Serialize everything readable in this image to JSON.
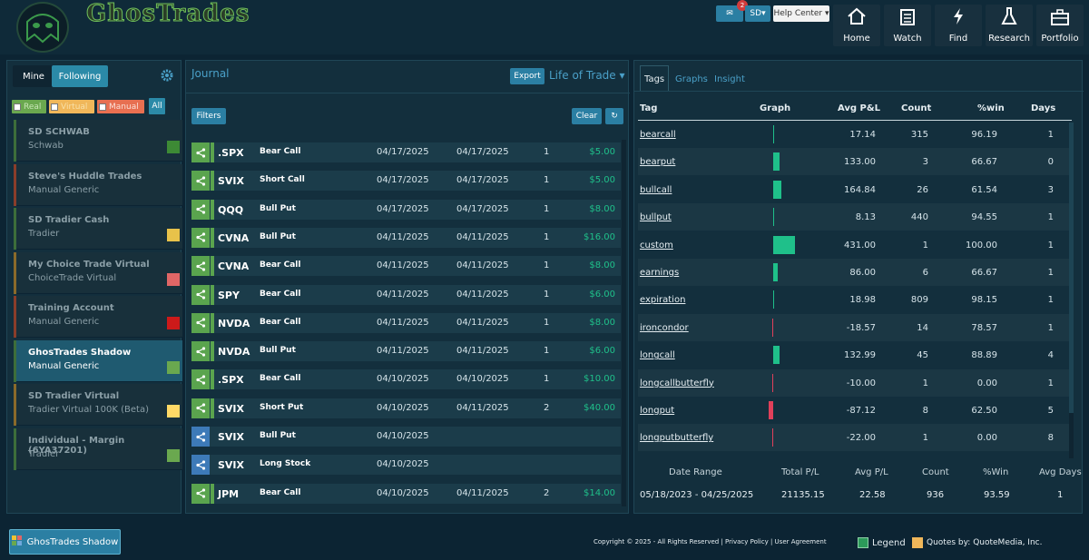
{
  "header": {
    "brand": "GhosTrades",
    "mail_count": "2",
    "user_initials": "SD",
    "help_label": "Help Center",
    "nav": [
      {
        "label": "Home",
        "icon": "home-icon"
      },
      {
        "label": "Watch",
        "icon": "clipboard-icon"
      },
      {
        "label": "Find",
        "icon": "lightning-icon"
      },
      {
        "label": "Research",
        "icon": "flask-icon"
      },
      {
        "label": "Portfolio",
        "icon": "briefcase-icon"
      }
    ]
  },
  "accounts_panel": {
    "tabs": [
      "Mine",
      "Following"
    ],
    "filters": [
      "Real",
      "Virtual",
      "Manual",
      "All"
    ],
    "accounts": [
      {
        "name": "SD SCHWAB",
        "type": "Schwab",
        "color": "#3d8a35"
      },
      {
        "name": "Steve's Huddle Trades",
        "type": "Manual Generic",
        "color": ""
      },
      {
        "name": "SD Tradier Cash",
        "type": "Tradier",
        "color": "#e8c24a"
      },
      {
        "name": "My Choice Trade Virtual",
        "type": "ChoiceTrade Virtual",
        "color": "#e06666"
      },
      {
        "name": "Training Account",
        "type": "Manual Generic",
        "color": "#cc1a1a"
      },
      {
        "name": "GhosTrades Shadow",
        "type": "Manual Generic",
        "color": "#6aa84f"
      },
      {
        "name": "SD Tradier Virtual",
        "type": "Tradier Virtual 100K (Beta)",
        "color": "#ffd966"
      },
      {
        "name": "Individual - Margin (6YA37201)",
        "type": "Tradier",
        "color": "#6aa84f"
      }
    ]
  },
  "journal": {
    "title": "Journal",
    "export_label": "Export",
    "view_label": "Life of Trade",
    "filters_label": "Filters",
    "clear_label": "Clear",
    "rows": [
      {
        "symbol": ".SPX",
        "strategy": "Bear Call",
        "opened": "04/17/2025",
        "closed": "04/17/2025",
        "count": "1",
        "pnl": "$5.00",
        "status": "closed"
      },
      {
        "symbol": "SVIX",
        "strategy": "Short Call",
        "opened": "04/17/2025",
        "closed": "04/17/2025",
        "count": "1",
        "pnl": "$5.00",
        "status": "closed"
      },
      {
        "symbol": "QQQ",
        "strategy": "Bull Put",
        "opened": "04/17/2025",
        "closed": "04/17/2025",
        "count": "1",
        "pnl": "$8.00",
        "status": "closed"
      },
      {
        "symbol": "CVNA",
        "strategy": "Bull Put",
        "opened": "04/11/2025",
        "closed": "04/11/2025",
        "count": "1",
        "pnl": "$16.00",
        "status": "closed"
      },
      {
        "symbol": "CVNA",
        "strategy": "Bear Call",
        "opened": "04/11/2025",
        "closed": "04/11/2025",
        "count": "1",
        "pnl": "$8.00",
        "status": "closed"
      },
      {
        "symbol": "SPY",
        "strategy": "Bear Call",
        "opened": "04/11/2025",
        "closed": "04/11/2025",
        "count": "1",
        "pnl": "$6.00",
        "status": "closed"
      },
      {
        "symbol": "NVDA",
        "strategy": "Bear Call",
        "opened": "04/11/2025",
        "closed": "04/11/2025",
        "count": "1",
        "pnl": "$8.00",
        "status": "closed"
      },
      {
        "symbol": "NVDA",
        "strategy": "Bull Put",
        "opened": "04/11/2025",
        "closed": "04/11/2025",
        "count": "1",
        "pnl": "$6.00",
        "status": "closed"
      },
      {
        "symbol": ".SPX",
        "strategy": "Bear Call",
        "opened": "04/10/2025",
        "closed": "04/10/2025",
        "count": "1",
        "pnl": "$10.00",
        "status": "closed"
      },
      {
        "symbol": "SVIX",
        "strategy": "Short Put",
        "opened": "04/10/2025",
        "closed": "04/11/2025",
        "count": "2",
        "pnl": "$40.00",
        "status": "closed"
      },
      {
        "symbol": "SVIX",
        "strategy": "Bull Put",
        "opened": "04/10/2025",
        "closed": "",
        "count": "",
        "pnl": "",
        "status": "open"
      },
      {
        "symbol": "SVIX",
        "strategy": "Long Stock",
        "opened": "04/10/2025",
        "closed": "",
        "count": "",
        "pnl": "",
        "status": "open"
      },
      {
        "symbol": "JPM",
        "strategy": "Bear Call",
        "opened": "04/10/2025",
        "closed": "04/11/2025",
        "count": "2",
        "pnl": "$14.00",
        "status": "closed"
      }
    ]
  },
  "tags_panel": {
    "tabs": [
      "Tags",
      "Graphs",
      "Insight"
    ],
    "columns": [
      "Tag",
      "Graph",
      "Avg P&L",
      "Count",
      "%win",
      "Days"
    ],
    "rows": [
      {
        "tag": "bearcall",
        "avg_pnl": "17.14",
        "count": "315",
        "win": "96.19",
        "days": "1",
        "graph_value": 17.14
      },
      {
        "tag": "bearput",
        "avg_pnl": "133.00",
        "count": "3",
        "win": "66.67",
        "days": "0",
        "graph_value": 133.0
      },
      {
        "tag": "bullcall",
        "avg_pnl": "164.84",
        "count": "26",
        "win": "61.54",
        "days": "3",
        "graph_value": 164.84
      },
      {
        "tag": "bullput",
        "avg_pnl": "8.13",
        "count": "440",
        "win": "94.55",
        "days": "1",
        "graph_value": 8.13
      },
      {
        "tag": "custom",
        "avg_pnl": "431.00",
        "count": "1",
        "win": "100.00",
        "days": "1",
        "graph_value": 431.0
      },
      {
        "tag": "earnings",
        "avg_pnl": "86.00",
        "count": "6",
        "win": "66.67",
        "days": "1",
        "graph_value": 86.0
      },
      {
        "tag": "expiration",
        "avg_pnl": "18.98",
        "count": "809",
        "win": "98.15",
        "days": "1",
        "graph_value": 18.98
      },
      {
        "tag": "ironcondor",
        "avg_pnl": "-18.57",
        "count": "14",
        "win": "78.57",
        "days": "1",
        "graph_value": -18.57
      },
      {
        "tag": "longcall",
        "avg_pnl": "132.99",
        "count": "45",
        "win": "88.89",
        "days": "4",
        "graph_value": 132.99
      },
      {
        "tag": "longcallbutterfly",
        "avg_pnl": "-10.00",
        "count": "1",
        "win": "0.00",
        "days": "1",
        "graph_value": -10.0
      },
      {
        "tag": "longput",
        "avg_pnl": "-87.12",
        "count": "8",
        "win": "62.50",
        "days": "5",
        "graph_value": -87.12
      },
      {
        "tag": "longputbutterfly",
        "avg_pnl": "-22.00",
        "count": "1",
        "win": "0.00",
        "days": "8",
        "graph_value": -22.0
      }
    ],
    "summary_headers": [
      "Date Range",
      "Total P/L",
      "Avg P/L",
      "Count",
      "%Win",
      "Avg Days"
    ],
    "summary_values": [
      "05/18/2023 - 04/25/2025",
      "21135.15",
      "22.58",
      "936",
      "93.59",
      "1"
    ]
  },
  "footer": {
    "account_button": "GhosTrades Shadow",
    "copyright": "Copyright © 2025 - All Rights Reserved | Privacy Policy | User Agreement",
    "legend": "Legend",
    "quotes": "Quotes by: QuoteMedia, Inc."
  },
  "colors": {
    "positive": "#1fc08a",
    "negative": "#e0405a",
    "accent": "#2b7fa3"
  }
}
